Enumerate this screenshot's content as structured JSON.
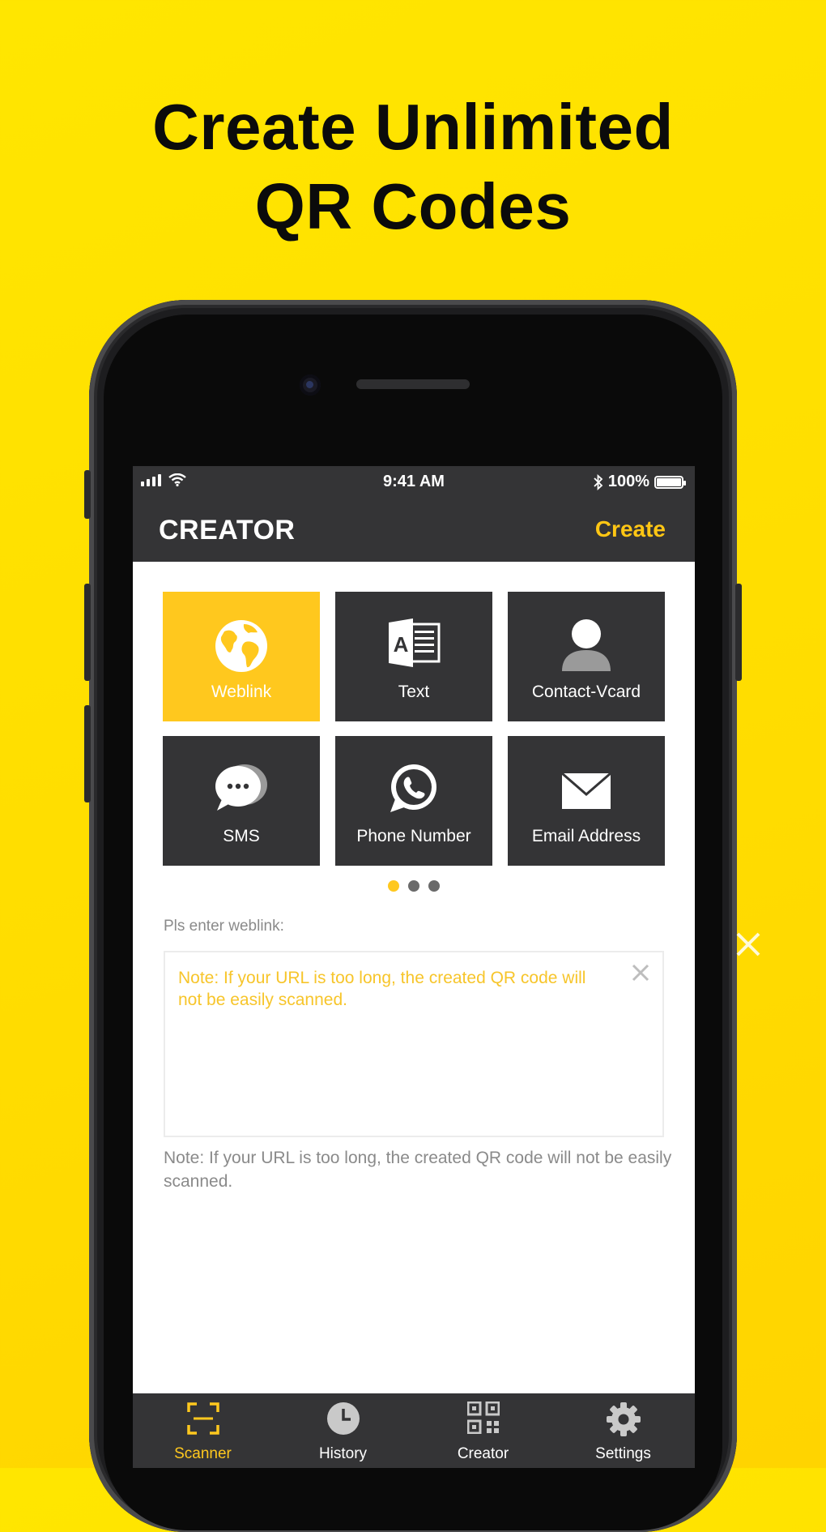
{
  "headline": {
    "line1": "Create Unlimited",
    "line2": "QR Codes"
  },
  "status_bar": {
    "time": "9:41 AM",
    "battery": "100%"
  },
  "nav": {
    "title": "CREATOR",
    "action": "Create"
  },
  "types": [
    {
      "label": "Weblink",
      "icon": "globe-icon",
      "active": true
    },
    {
      "label": "Text",
      "icon": "text-document-icon",
      "active": false
    },
    {
      "label": "Contact-Vcard",
      "icon": "person-icon",
      "active": false
    },
    {
      "label": "SMS",
      "icon": "chat-bubble-icon",
      "active": false
    },
    {
      "label": "Phone Number",
      "icon": "phone-icon",
      "active": false
    },
    {
      "label": "Email Address",
      "icon": "envelope-icon",
      "active": false
    }
  ],
  "pagination": {
    "pages": 3,
    "current": 1
  },
  "form": {
    "prompt": "Pls enter weblink:",
    "placeholder": "Note: If your URL is too long, the created QR code will not be easily scanned.",
    "note": "Note: If your URL is too long, the created QR code will not be easily scanned."
  },
  "tabs": [
    {
      "label": "Scanner",
      "icon": "scanner-icon",
      "active": true
    },
    {
      "label": "History",
      "icon": "clock-icon",
      "active": false
    },
    {
      "label": "Creator",
      "icon": "qr-code-icon",
      "active": false
    },
    {
      "label": "Settings",
      "icon": "gear-icon",
      "active": false
    }
  ],
  "colors": {
    "background": "#ffe000",
    "accent": "#ffc81e",
    "dark": "#343436",
    "note_text": "#8a8a8a"
  }
}
